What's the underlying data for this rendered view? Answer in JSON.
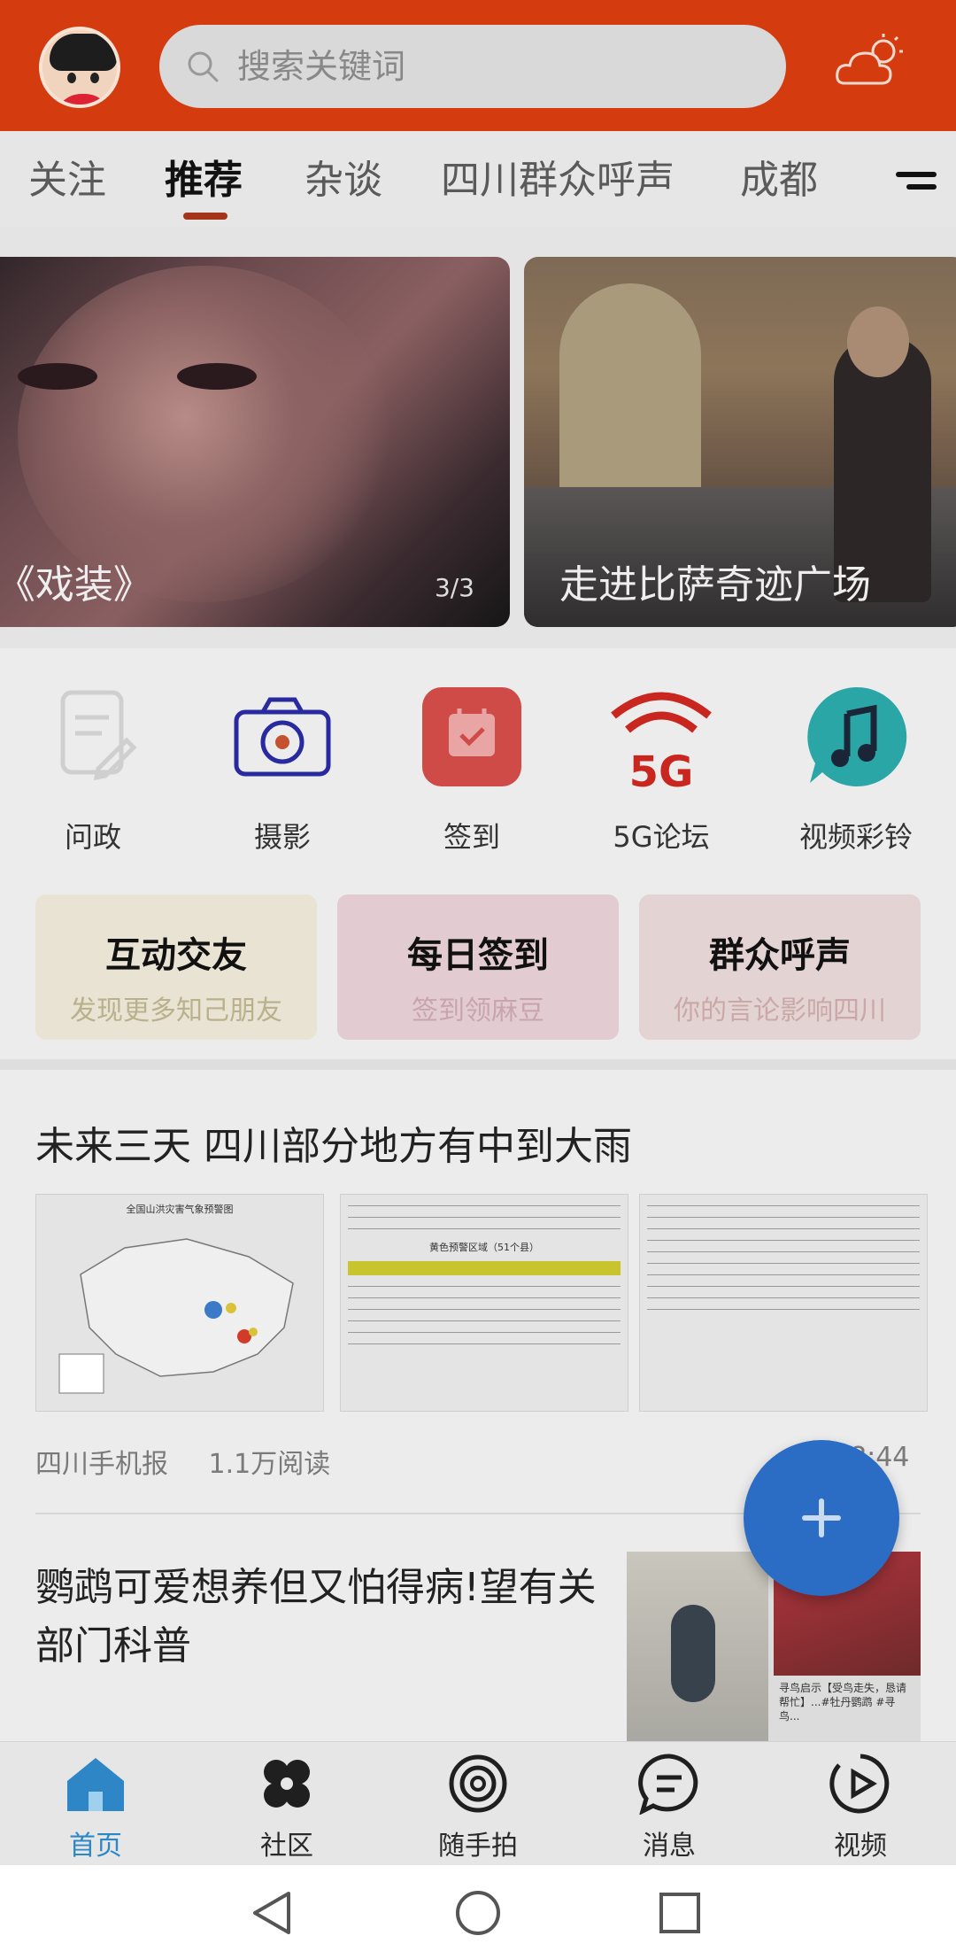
{
  "header": {
    "search_placeholder": "搜索关键词",
    "icons": [
      "avatar",
      "search-icon",
      "weather-icon"
    ]
  },
  "tabs": [
    {
      "label": "关注",
      "active": false
    },
    {
      "label": "推荐",
      "active": true
    },
    {
      "label": "杂谈",
      "active": false
    },
    {
      "label": "四川群众呼声",
      "active": false
    },
    {
      "label": "成都",
      "active": false
    }
  ],
  "carousel": [
    {
      "caption": "-《戏装》",
      "pager": "3/3"
    },
    {
      "caption": "走进比萨奇迹广场"
    }
  ],
  "quick_actions": [
    {
      "label": "问政",
      "icon": "document-edit-icon"
    },
    {
      "label": "摄影",
      "icon": "camera-icon"
    },
    {
      "label": "签到",
      "icon": "calendar-check-icon"
    },
    {
      "label": "5G论坛",
      "icon": "5g-wifi-icon"
    },
    {
      "label": "视频彩铃",
      "icon": "music-note-icon"
    }
  ],
  "features": [
    {
      "title": "互动交友",
      "subtitle": "发现更多知己朋友"
    },
    {
      "title": "每日签到",
      "subtitle": "签到领麻豆"
    },
    {
      "title": "群众呼声",
      "subtitle": "你的言论影响四川"
    }
  ],
  "news": [
    {
      "title": "未来三天 四川部分地方有中到大雨",
      "source": "四川手机报",
      "reads": "1.1万阅读",
      "time": "8:44",
      "thumb_caption": "全国山洪灾害气象预警图",
      "table_heading": "黄色预警区域（51个县）"
    },
    {
      "title": "鹦鹉可爱想养但又怕得病!望有关部门科普",
      "thumb_caption": "寻鸟启示【受鸟走失，恳请帮忙】...#牡丹鹦鹉 #寻鸟..."
    }
  ],
  "bottom_nav": [
    {
      "label": "首页",
      "icon": "home-icon",
      "active": true
    },
    {
      "label": "社区",
      "icon": "community-icon",
      "active": false
    },
    {
      "label": "随手拍",
      "icon": "snapshot-icon",
      "active": false
    },
    {
      "label": "消息",
      "icon": "message-icon",
      "active": false
    },
    {
      "label": "视频",
      "icon": "video-icon",
      "active": false
    }
  ],
  "colors": {
    "header": "#d43c10",
    "tab_underline": "#a4341a",
    "fab": "#2b6cc4",
    "nav_active": "#2b88c8"
  }
}
